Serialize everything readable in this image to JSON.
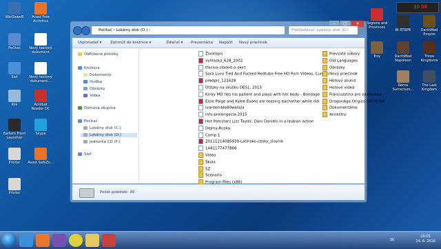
{
  "desktop_left": [
    {
      "label": "WarSaweR"
    },
    {
      "label": "Avast Free Antivirus"
    },
    {
      "label": "Počítač"
    },
    {
      "label": "Nový textový dokument"
    },
    {
      "label": "Sieť"
    },
    {
      "label": "Nový textový dokument..."
    },
    {
      "label": "Kôš"
    },
    {
      "label": "Acrobat Reader DC"
    },
    {
      "label": "Eartern Front Launcher"
    },
    {
      "label": "Skype"
    },
    {
      "label": "Printer"
    },
    {
      "label": "Avast SafeZo..."
    },
    {
      "label": "Printer"
    }
  ],
  "desktop_right": [
    {
      "label": "Regions and Provinces"
    },
    {
      "label": "BI-RTRPE"
    },
    {
      "label": "DarthMod Empire"
    },
    {
      "label": "Troy"
    },
    {
      "label": "DarthMod Napoleon"
    },
    {
      "label": "Three Kingdoms"
    },
    {
      "label": "Roma Surrectum..."
    },
    {
      "label": "The Last Kingdom"
    }
  ],
  "window": {
    "address": "Počítač  ›  Lokálny disk (D:)  ›",
    "search_placeholder": "Prehľadávať: Lokálny disk (D:)",
    "toolbar": [
      "Usporiadať ▾",
      "Zahrnúť do knižnice ▾",
      "Zdieľať ▾",
      "Prezentácia",
      "Napáliť",
      "Nový priečinok"
    ],
    "sidebar": [
      "Obľúbené položky",
      "Knižnice",
      "Dokumenty",
      "Hudba",
      "Obrázky",
      "Videá",
      "Domáca skupina",
      "Počítač",
      "Lokálny disk (C:)",
      "Lokálny disk (D:)",
      "Jednotka CD (F:)",
      "Sieť"
    ],
    "files_col1": [
      "Životopis",
      "vyhlaska_628_2002",
      "tfaciva-zladoit-o-skirt",
      "Sara Luvv Tied And Fucked Redtube Free HD Porn Videos, Cumoh",
      "predpis_122429",
      "Otázky na skúšku DES1, 2015",
      "Kinky MD ties his patient and plays with her body - Bondage",
      "Eizie Paige and Kylee Evans are teasing eachother while ridi",
      "ivantemble80walisia",
      "info-prolongacia-2015",
      "Hot Pornstars Lizz Tayler, Dani Daniels in a lesbian action",
      "Dejmy-Ruska",
      "Comp 1",
      "20111214085939-Latinsko-cesky_slovnik",
      "1441177477866",
      "Video",
      "Škola",
      "SZ",
      "Scenario",
      "Program Files (x86)"
    ],
    "files_col2": [
      "Prevzaté súbory",
      "Old Languages",
      "Obrázky",
      "Nový priečinok",
      "Hotový sound",
      "Hotové videá",
      "Francuzstina pre zamoukov",
      "DragonAge.Origins.SKIDROW",
      "Dokumentáme",
      "Ancestry"
    ],
    "status": "Počet položiek: 30",
    "title_buttons": [
      "–",
      "□",
      "✕"
    ]
  },
  "taskbar": {
    "lang": "SK",
    "time": "20:01",
    "date": "14. 6. 2016"
  },
  "gadget_text": "30  08"
}
